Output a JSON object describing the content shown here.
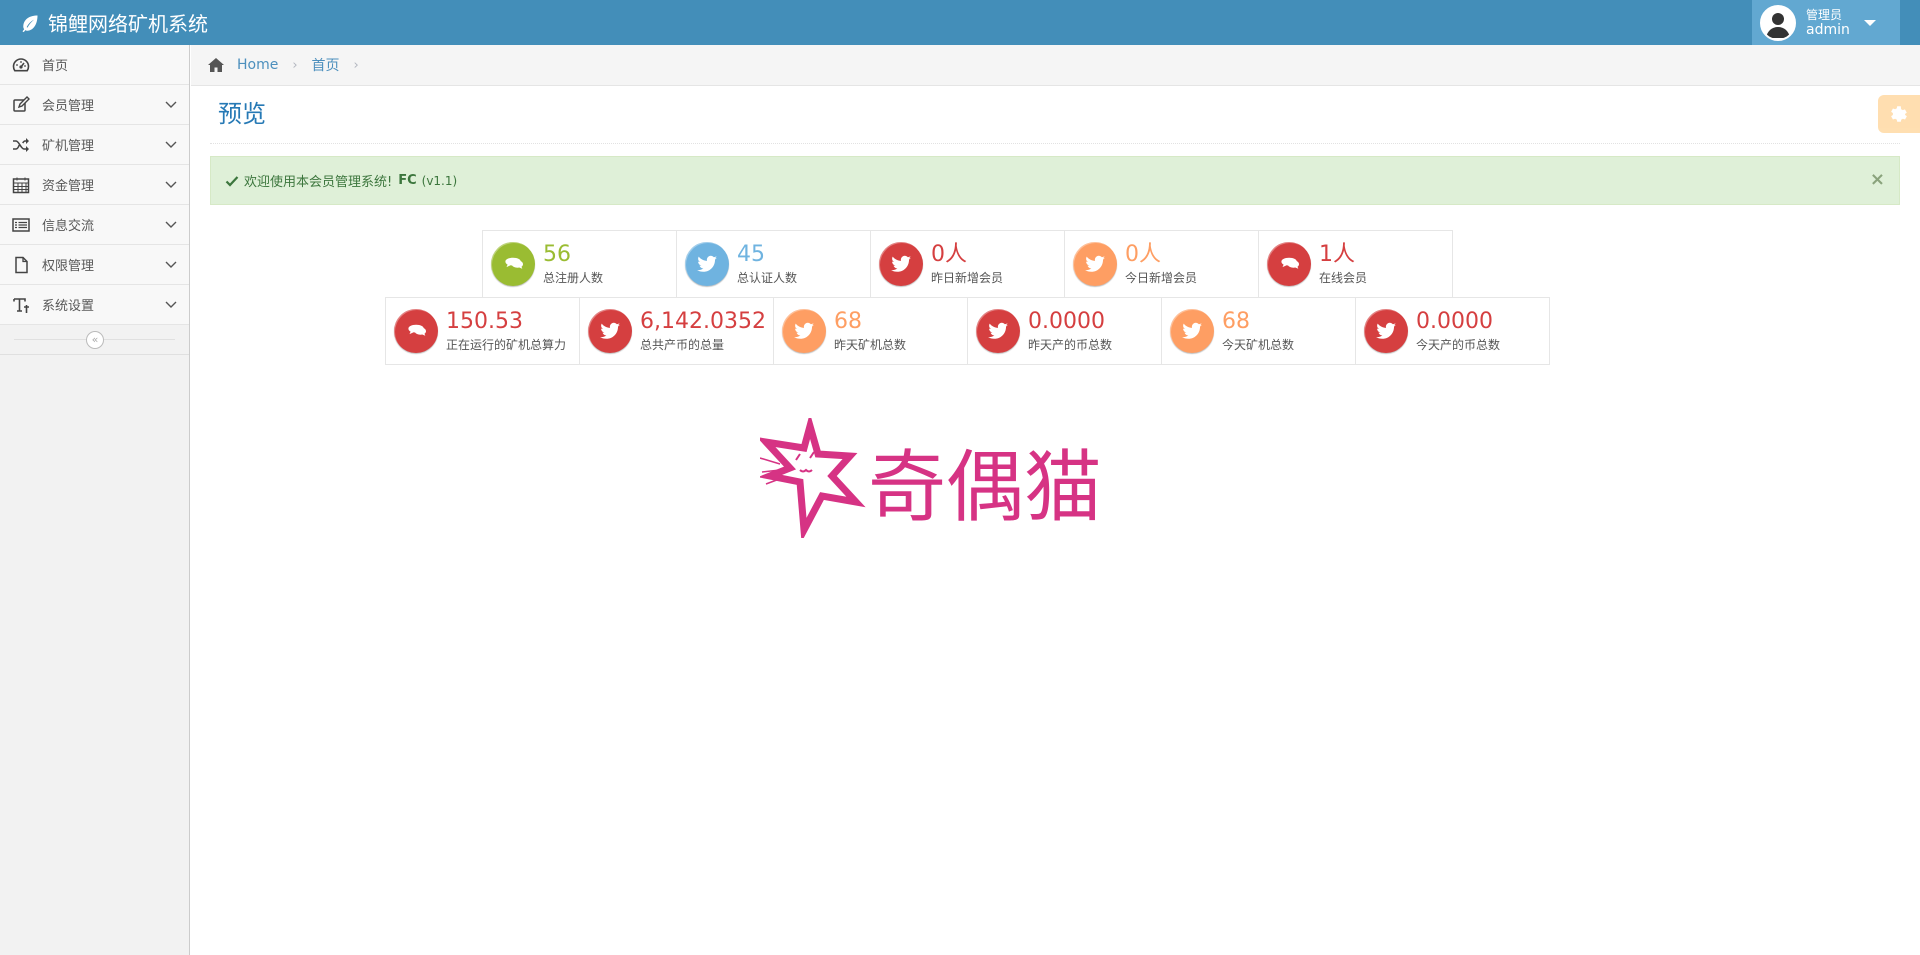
{
  "app": {
    "title": "锦鲤网络矿机系统",
    "brand_icon": "leaf-icon"
  },
  "user": {
    "role": "管理员",
    "name": "admin"
  },
  "sidebar": {
    "items": [
      {
        "label": "首页",
        "icon": "dashboard-icon"
      },
      {
        "label": "会员管理",
        "icon": "edit-icon"
      },
      {
        "label": "矿机管理",
        "icon": "random-icon"
      },
      {
        "label": "资金管理",
        "icon": "calendar-icon"
      },
      {
        "label": "信息交流",
        "icon": "list-icon"
      },
      {
        "label": "权限管理",
        "icon": "file-icon"
      },
      {
        "label": "系统设置",
        "icon": "text-icon"
      }
    ],
    "collapse_glyph": "«"
  },
  "breadcrumbs": {
    "home": "Home",
    "current": "首页",
    "sep": "›"
  },
  "page": {
    "title": "预览"
  },
  "alert": {
    "text": "欢迎使用本会员管理系统!",
    "product": "FC",
    "version": "(v1.1)",
    "close": "×"
  },
  "stats_row1": [
    {
      "value": "56",
      "label": "总注册人数",
      "icon": "comments-icon",
      "color": "#9abc32"
    },
    {
      "value": "45",
      "label": "总认证人数",
      "icon": "twitter-icon",
      "color": "#6fb3e0"
    },
    {
      "value": "0人",
      "label": "昨日新增会员",
      "icon": "twitter-icon",
      "color": "#d53f40"
    },
    {
      "value": "0人",
      "label": "今日新增会员",
      "icon": "twitter-icon",
      "color": "#fe9e63"
    },
    {
      "value": "1人",
      "label": "在线会员",
      "icon": "comments-icon",
      "color": "#d53f40"
    }
  ],
  "stats_row2": [
    {
      "value": "150.53",
      "label": "正在运行的矿机总算力",
      "icon": "comments-icon",
      "color": "#d53f40"
    },
    {
      "value": "6,142.0352",
      "label": "总共产币的总量",
      "icon": "twitter-icon",
      "color": "#d53f40"
    },
    {
      "value": "68",
      "label": "昨天矿机总数",
      "icon": "twitter-icon",
      "color": "#fe9e63"
    },
    {
      "value": "0.0000",
      "label": "昨天产的币总数",
      "icon": "twitter-icon",
      "color": "#d53f40"
    },
    {
      "value": "68",
      "label": "今天矿机总数",
      "icon": "twitter-icon",
      "color": "#fe9e63"
    },
    {
      "value": "0.0000",
      "label": "今天产的币总数",
      "icon": "twitter-icon",
      "color": "#d53f40"
    }
  ],
  "logo": {
    "text": "奇偶猫",
    "color": "#d63384"
  },
  "colors": {
    "navbar": "#438eb9",
    "user_menu": "#62a8d1",
    "link": "#4c8fbd",
    "title": "#2679b5",
    "alert_bg": "#dff0d8",
    "alert_text": "#3c763d"
  }
}
